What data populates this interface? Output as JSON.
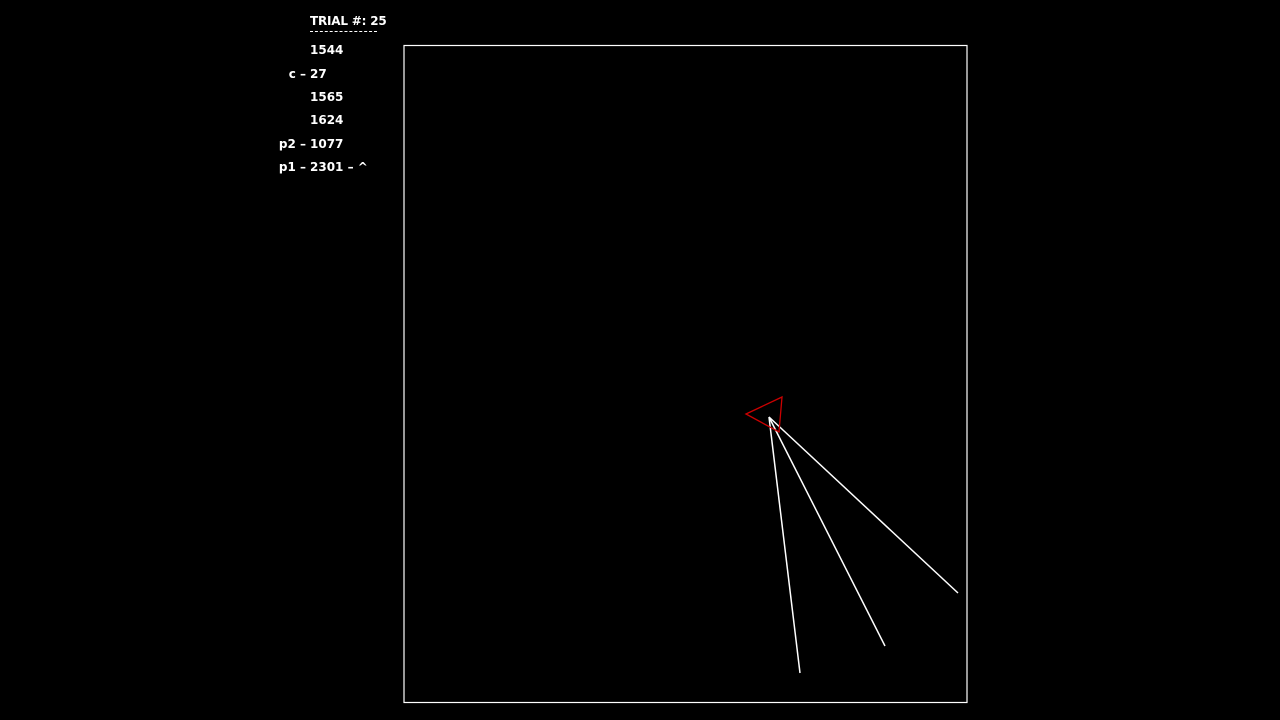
{
  "hud": {
    "trial_label": "TRIAL #: 25",
    "rows": [
      {
        "label": "",
        "value": "1544"
      },
      {
        "label": "c –",
        "value": "27"
      },
      {
        "label": "",
        "value": "1565"
      },
      {
        "label": "",
        "value": "1624"
      },
      {
        "label": "p2 –",
        "value": "1077"
      },
      {
        "label": "p1 –",
        "value": "2301 – ^"
      }
    ]
  },
  "arena": {
    "border_color": "#ffffff",
    "background": "#000000",
    "cursor_color": "#cc0000",
    "ray_color": "#ffffff"
  }
}
